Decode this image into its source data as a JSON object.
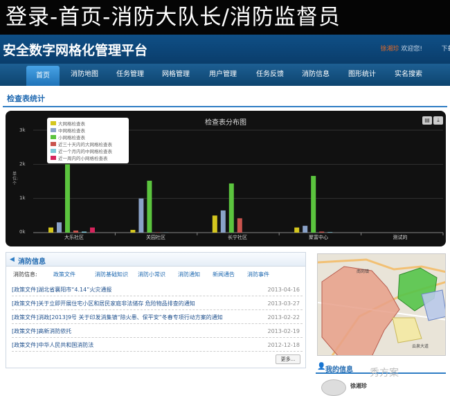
{
  "banner": {
    "text": "登录-首页-消防大队长/消防监督员"
  },
  "header": {
    "app_title": "安全数字网格化管理平台",
    "user_name": "徐湘珍",
    "welcome": "欢迎您!",
    "download": "下载客"
  },
  "nav": {
    "items": [
      {
        "label": "首页",
        "active": true
      },
      {
        "label": "消防地图",
        "active": false
      },
      {
        "label": "任务管理",
        "active": false
      },
      {
        "label": "网格管理",
        "active": false
      },
      {
        "label": "用户管理",
        "active": false
      },
      {
        "label": "任务反馈",
        "active": false
      },
      {
        "label": "消防信息",
        "active": false
      },
      {
        "label": "图形统计",
        "active": false
      },
      {
        "label": "实名搜索",
        "active": false
      }
    ]
  },
  "section": {
    "title": "检查表统计"
  },
  "chart_data": {
    "type": "bar",
    "title": "检查表分布图",
    "ylabel": "单位:个",
    "ylim": [
      0,
      3000
    ],
    "yticks": [
      "0k",
      "1k",
      "2k",
      "3k"
    ],
    "categories": [
      "大乐社区",
      "关园社区",
      "长宁社区",
      "聚富中心",
      "测试的"
    ],
    "series": [
      {
        "name": "大网格检查表",
        "color": "#d4c61e",
        "values": [
          150,
          80,
          500,
          150,
          0
        ]
      },
      {
        "name": "中网格检查表",
        "color": "#8aa2c8",
        "values": [
          300,
          1000,
          650,
          200,
          0
        ]
      },
      {
        "name": "小网格检查表",
        "color": "#5bc43e",
        "values": [
          2000,
          1520,
          1440,
          1660,
          0
        ]
      },
      {
        "name": "近三十天内的大网格检查表",
        "color": "#c9534d",
        "values": [
          60,
          10,
          420,
          30,
          0
        ]
      },
      {
        "name": "近一个月内的中网格检查表",
        "color": "#7fc8d8",
        "values": [
          30,
          5,
          0,
          15,
          0
        ]
      },
      {
        "name": "近一周内的小网格检查表",
        "color": "#d6245c",
        "values": [
          150,
          0,
          0,
          0,
          0
        ]
      }
    ],
    "grid": true,
    "legend": "top-left"
  },
  "chart_buttons": {
    "print": "▤",
    "download": "⤓"
  },
  "news": {
    "title": "消防信息",
    "icon": "speaker-icon",
    "tabs_label": "消防信息:",
    "tabs": [
      "政策文件",
      "消防基础知识",
      "消防小常识",
      "消防通知",
      "新闻通告",
      "消防事件"
    ],
    "rows": [
      {
        "title": "[政策文件]湖北省襄阳市“4.14”火灾通报",
        "date": "2013-04-16"
      },
      {
        "title": "[政策文件]关于立即开展住宅小区和居民家庭非法储存 危险物品排查的通知",
        "date": "2013-03-27"
      },
      {
        "title": "[政策文件]消政[2013]9号 关于印发消集镇“除火患、保平安”冬春专项行动方案的通知",
        "date": "2013-02-22"
      },
      {
        "title": "[政策文件]高新消防依托",
        "date": "2013-02-19"
      },
      {
        "title": "[政策文件]中华人民共和国消防法",
        "date": "2012-12-18"
      }
    ],
    "more": "更多..."
  },
  "map": {
    "label_top": "南岗镇",
    "label_bottom": "云泉大道"
  },
  "my_info": {
    "title": "我的信息",
    "name": "徐湘珍"
  },
  "watermark": "秀方案"
}
